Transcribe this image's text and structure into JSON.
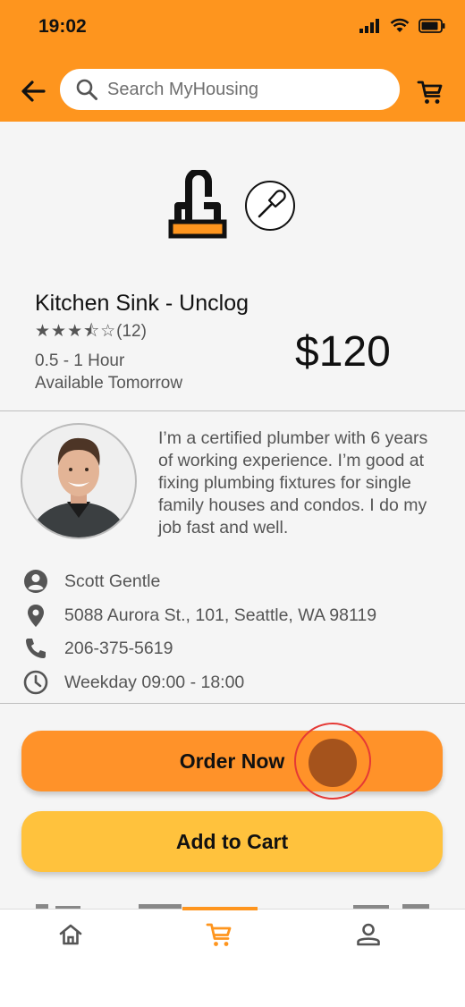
{
  "status_bar": {
    "time": "19:02"
  },
  "header": {
    "search_placeholder": "Search MyHousing"
  },
  "service": {
    "title": "Kitchen Sink - Unclog",
    "stars_glyphs": "★★★⯪☆",
    "rating": 3.5,
    "review_count": "(12)",
    "duration": "0.5 - 1 Hour",
    "availability": "Available Tomorrow",
    "price": "$120"
  },
  "provider": {
    "bio": "I’m a certified plumber with 6 years of working experience. I’m good at fixing plumbing fixtures for single family houses and condos. I do my job fast and well.",
    "name": "Scott Gentle",
    "address": "5088 Aurora St., 101, Seattle, WA 98119",
    "phone": "206-375-5619",
    "hours": "Weekday 09:00 - 18:00"
  },
  "actions": {
    "order_now": "Order Now",
    "add_to_cart": "Add to Cart"
  },
  "bottom_nav": {
    "items": [
      {
        "icon": "home-icon",
        "active": false
      },
      {
        "icon": "cart-icon",
        "active": true
      },
      {
        "icon": "profile-icon",
        "active": false
      }
    ]
  },
  "colors": {
    "header_bg": "#fe951e",
    "order_button": "#ff9229",
    "cart_button": "#ffc23d",
    "active_nav": "#fe951e",
    "touch_indicator": "#a5531c",
    "touch_ring": "#e53935"
  },
  "icons": {
    "back": "arrow-left-icon",
    "search": "search-icon",
    "cart": "cart-icon",
    "faucet": "faucet-icon",
    "plunger": "plunger-icon",
    "person": "person-icon",
    "location": "location-pin-icon",
    "phone": "phone-icon",
    "clock": "clock-icon"
  }
}
